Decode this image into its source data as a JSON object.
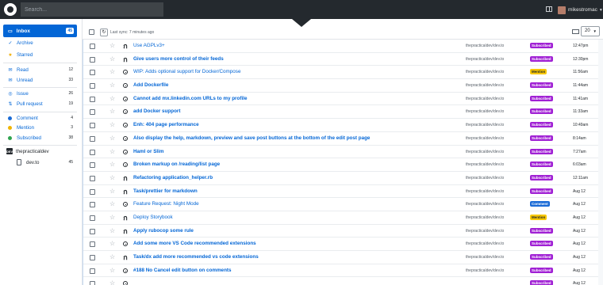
{
  "topbar": {
    "search_placeholder": "Search...",
    "username": "mikestromac"
  },
  "sidebar": {
    "inbox": {
      "label": "Inbox",
      "count": "45"
    },
    "archive": "Archive",
    "starred": "Starred",
    "read": {
      "label": "Read",
      "count": "12"
    },
    "unread": {
      "label": "Unread",
      "count": "33"
    },
    "issue": {
      "label": "Issue",
      "count": "26"
    },
    "pull_request": {
      "label": "Pull request",
      "count": "19"
    },
    "comment": {
      "label": "Comment",
      "count": "4"
    },
    "mention": {
      "label": "Mention",
      "count": "3"
    },
    "subscribed": {
      "label": "Subscribed",
      "count": "38"
    },
    "org": {
      "label": "thepracticaldev",
      "icon_text": "DEV"
    },
    "repo": {
      "label": "dev.to",
      "count": "45"
    }
  },
  "toolbar": {
    "last_sync": "Last sync: 7 minutes ago",
    "per_page": "20"
  },
  "colors": {
    "subscribed": "#a020d4",
    "mention": "#f7c700",
    "comment": "#1a6bd6",
    "accent": "#0366d6"
  },
  "rows": [
    {
      "type": "pr",
      "title": "Use AGPLv3+",
      "bold": false,
      "repo": "thepracticaldev/dev.to",
      "badge": "Subscribed",
      "time": "12:47pm"
    },
    {
      "type": "pr",
      "title": "Give users more control of their feeds",
      "bold": true,
      "repo": "thepracticaldev/dev.to",
      "badge": "Subscribed",
      "time": "12:30pm"
    },
    {
      "type": "issue",
      "title": "WIP: Adds optional support for Docker/Compose",
      "bold": false,
      "repo": "thepracticaldev/dev.to",
      "badge": "Mention",
      "time": "11:56am"
    },
    {
      "type": "issue",
      "title": "Add Dockerfile",
      "bold": true,
      "repo": "thepracticaldev/dev.to",
      "badge": "Subscribed",
      "time": "11:44am"
    },
    {
      "type": "issue",
      "title": "Cannot add mx.linkedin.com URLs to my profile",
      "bold": true,
      "repo": "thepracticaldev/dev.to",
      "badge": "Subscribed",
      "time": "11:41am"
    },
    {
      "type": "issue",
      "title": "add Docker support",
      "bold": true,
      "repo": "thepracticaldev/dev.to",
      "badge": "Subscribed",
      "time": "11:33am"
    },
    {
      "type": "issue",
      "title": "Enh: 404 page performance",
      "bold": true,
      "repo": "thepracticaldev/dev.to",
      "badge": "Subscribed",
      "time": "10:49am"
    },
    {
      "type": "issue",
      "title": "Also display the help, markdown, preview and save post buttons at the bottom of the edit post page",
      "bold": true,
      "repo": "thepracticaldev/dev.to",
      "badge": "Subscribed",
      "time": "8:14am"
    },
    {
      "type": "issue",
      "title": "Haml or Slim",
      "bold": true,
      "repo": "thepracticaldev/dev.to",
      "badge": "Subscribed",
      "time": "7:27am"
    },
    {
      "type": "issue",
      "title": "Broken markup on /reading/list page",
      "bold": true,
      "repo": "thepracticaldev/dev.to",
      "badge": "Subscribed",
      "time": "6:03am"
    },
    {
      "type": "pr",
      "title": "Refactoring application_helper.rb",
      "bold": true,
      "repo": "thepracticaldev/dev.to",
      "badge": "Subscribed",
      "time": "12:11am"
    },
    {
      "type": "pr",
      "title": "Task/prettier for markdown",
      "bold": true,
      "repo": "thepracticaldev/dev.to",
      "badge": "Subscribed",
      "time": "Aug 12"
    },
    {
      "type": "issue",
      "title": "Feature Request: Night Mode",
      "bold": false,
      "repo": "thepracticaldev/dev.to",
      "badge": "Comment",
      "time": "Aug 12"
    },
    {
      "type": "pr",
      "title": "Deploy Storybook",
      "bold": false,
      "repo": "thepracticaldev/dev.to",
      "badge": "Mention",
      "time": "Aug 12"
    },
    {
      "type": "pr",
      "title": "Apply rubocop some rule",
      "bold": true,
      "repo": "thepracticaldev/dev.to",
      "badge": "Subscribed",
      "time": "Aug 12"
    },
    {
      "type": "issue",
      "title": "Add some more VS Code recommended extensions",
      "bold": true,
      "repo": "thepracticaldev/dev.to",
      "badge": "Subscribed",
      "time": "Aug 12"
    },
    {
      "type": "pr",
      "title": "Task/dx add more recommended vs code extensions",
      "bold": true,
      "repo": "thepracticaldev/dev.to",
      "badge": "Subscribed",
      "time": "Aug 12"
    },
    {
      "type": "issue",
      "title": "#188 No Cancel edit button on comments",
      "bold": true,
      "repo": "thepracticaldev/dev.to",
      "badge": "Subscribed",
      "time": "Aug 12"
    },
    {
      "type": "issue",
      "title": "",
      "bold": true,
      "repo": "",
      "badge": "Subscribed",
      "time": "Aug 12"
    }
  ]
}
